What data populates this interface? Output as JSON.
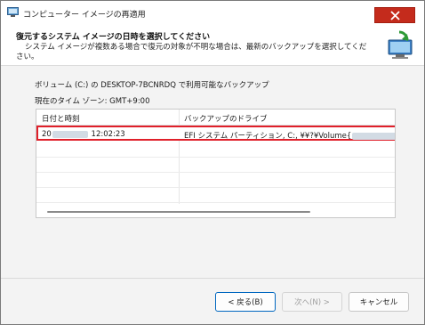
{
  "window": {
    "title": "コンピューター イメージの再適用"
  },
  "header": {
    "title": "復元するシステム イメージの日時を選択してください",
    "description": "システム イメージが複数ある場合で復元の対象が不明な場合は、最新のバックアップを選択してください。"
  },
  "info": {
    "volume": "ボリューム (C:) の DESKTOP-7BCNRDQ で利用可能なバックアップ",
    "timezone": "現在のタイム ゾーン: GMT+9:00"
  },
  "table": {
    "columns": [
      "日付と時刻",
      "バックアップのドライブ"
    ],
    "rows": [
      {
        "date_prefix": "20",
        "time": "12:02:23",
        "drive_prefix": "EFI システム パーティション, C:, ¥¥?¥Volume{",
        "selected": true
      }
    ]
  },
  "buttons": {
    "back": "< 戻る(B)",
    "next": "次へ(N) >",
    "cancel": "キャンセル"
  },
  "colors": {
    "selection_highlight": "#e0202a",
    "close_button": "#c42b1c",
    "primary_border": "#0067c0"
  }
}
